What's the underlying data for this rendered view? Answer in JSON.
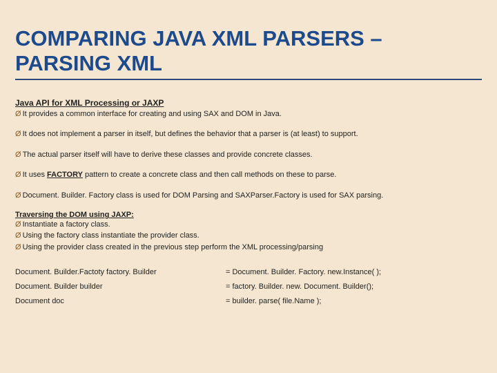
{
  "title": "COMPARING JAVA XML PARSERS – PARSING XML",
  "sectionTitle": "Java API for XML Processing or JAXP",
  "bullets": [
    "It provides a common interface for creating and using SAX and DOM in Java.",
    "It does not implement a parser in itself, but defines the behavior that a parser is (at least) to support.",
    "The actual parser itself will have to derive these classes and provide concrete classes.",
    {
      "pre": "It uses ",
      "bold": "FACTORY",
      "post": " pattern to create a concrete class and then call methods on these to parse."
    },
    "Document. Builder. Factory class is used for DOM Parsing and SAXParser.Factory is used for SAX parsing."
  ],
  "subheading": "Traversing the DOM using JAXP:",
  "steps": [
    "Instantiate a factory class.",
    "Using the factory class instantiate the provider class.",
    "Using the provider class created in the previous step perform the XML processing/parsing"
  ],
  "code": {
    "left": [
      "Document. Builder.Factoty factory. Builder",
      "Document. Builder builder",
      "Document doc"
    ],
    "right": [
      "= Document. Builder. Factory. new.Instance( );",
      "= factory. Builder. new. Document. Builder();",
      "= builder. parse( file.Name );"
    ]
  }
}
